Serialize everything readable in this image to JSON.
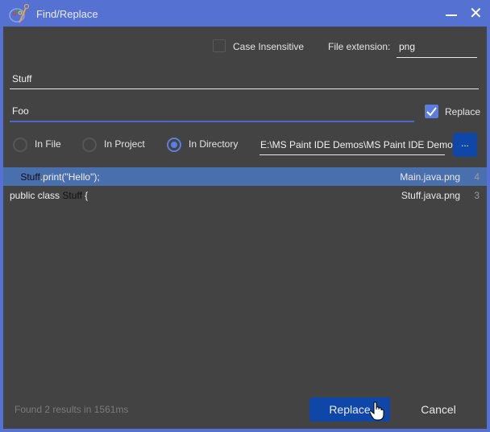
{
  "window": {
    "title": "Find/Replace",
    "icon": "paint-palette-icon",
    "minimize_icon": "minimize-icon",
    "close_icon": "close-icon",
    "close_glyph": "✕"
  },
  "options": {
    "case_insensitive_label": "Case Insensitive",
    "case_insensitive_checked": false,
    "file_extension_label": "File extension:",
    "file_extension_value": "png"
  },
  "search": {
    "find_value": "Stuff",
    "replace_value": "Foo",
    "replace_checkbox_label": "Replace",
    "replace_checked": true
  },
  "scope": {
    "options": [
      {
        "label": "In File",
        "selected": false
      },
      {
        "label": "In Project",
        "selected": false
      },
      {
        "label": "In Directory",
        "selected": true
      }
    ],
    "directory_path": "E:\\MS Paint IDE Demos\\MS Paint IDE Demo",
    "browse_label": "..."
  },
  "results": [
    {
      "prefix": "    ",
      "match": "Stuff",
      "suffix": ".print(\"Hello\");",
      "file": "Main.java.png",
      "line": "4",
      "selected": true
    },
    {
      "prefix": "public class ",
      "match": "Stuff",
      "suffix": " {",
      "file": "Stuff.java.png",
      "line": "3",
      "selected": false
    }
  ],
  "footer": {
    "status": "Found 2 results in 1561ms",
    "replace_button": "Replace",
    "cancel_button": "Cancel"
  },
  "colors": {
    "accent": "#5572d3",
    "primary_button": "#0e47a8",
    "selection": "#4a6fad",
    "background": "#434343"
  }
}
